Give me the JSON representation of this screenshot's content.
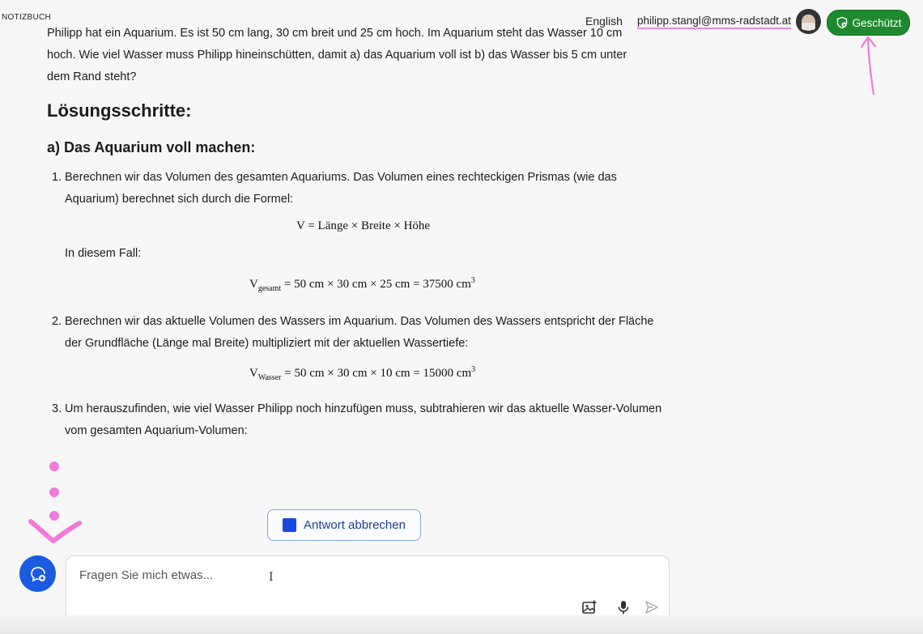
{
  "header": {
    "app_label": "NOTIZBUCH",
    "language": "English",
    "user_email": "philipp.stangl@mms-radstadt.at",
    "protected_label": "Geschützt"
  },
  "article": {
    "intro_lines": [
      "Philipp hat ein Aquarium. Es ist 50 cm lang, 30 cm breit und 25 cm hoch. Im Aquarium steht das Wasser 10 cm",
      "hoch. Wie viel Wasser muss Philipp hineinschütten, damit a) das Aquarium voll ist b) das Wasser bis 5 cm unter",
      "dem Rand steht?"
    ],
    "heading": "Lösungsschritte:",
    "subheading": "a) Das Aquarium voll machen:",
    "steps": [
      {
        "num": "1.",
        "text": "Berechnen wir das Volumen des gesamten Aquariums. Das Volumen eines rechteckigen Prismas (wie das Aquarium) berechnet sich durch die Formel:",
        "formula": "V = Länge × Breite × Höhe",
        "after": "In diesem Fall:",
        "formula2_var": "V",
        "formula2_sub": "gesamt",
        "formula2_rhs": " = 50 cm × 30 cm × 25 cm = 37500 cm",
        "formula2_sup": "3"
      },
      {
        "num": "2.",
        "text": "Berechnen wir das aktuelle Volumen des Wassers im Aquarium. Das Volumen des Wassers entspricht der Fläche der Grundfläche (Länge mal Breite) multipliziert mit der aktuellen Wassertiefe:",
        "formula_var": "V",
        "formula_sub": "Wasser",
        "formula_rhs": " = 50 cm × 30 cm × 10 cm = 15000 cm",
        "formula_sup": "3"
      },
      {
        "num": "3.",
        "text": "Um herauszufinden, wie viel Wasser Philipp noch hinzufügen muss, subtrahieren wir das aktuelle Wasser-Volumen vom gesamten Aquarium-Volumen:"
      }
    ]
  },
  "controls": {
    "stop_label": "Antwort abbrechen",
    "input_placeholder": "Fragen Sie mich etwas...",
    "input_value": ""
  },
  "icons": {
    "new_chat": "new-chat-icon",
    "image_upload": "image-upload-icon",
    "microphone": "microphone-icon",
    "send": "send-icon",
    "shield": "shield-check-icon"
  },
  "colors": {
    "accent_blue": "#1a5be0",
    "protected_green": "#1e8a2d",
    "annotation_pink": "#f07ad8"
  }
}
